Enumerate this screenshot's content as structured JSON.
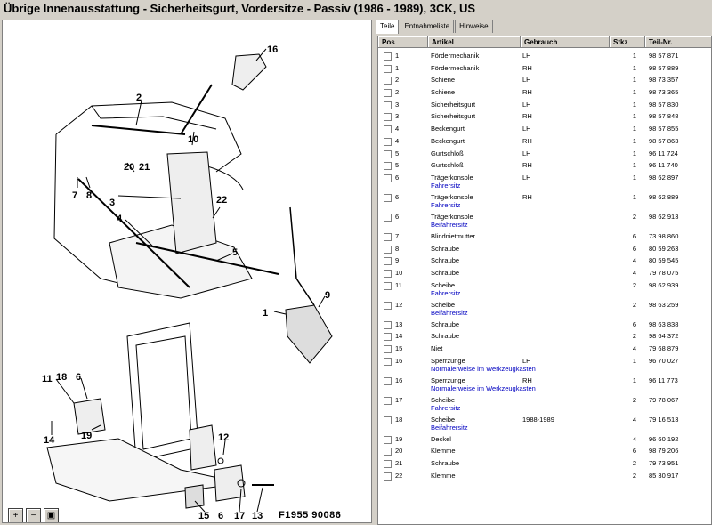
{
  "window": {
    "title": "Übrige Innenausstattung - Sicherheitsgurt, Vordersitze - Passiv   (1986 - 1989), 3CK, US"
  },
  "diagram": {
    "figure_label": "F1955   90086",
    "callouts": [
      "16",
      "2",
      "10",
      "20",
      "21",
      "7",
      "8",
      "3",
      "4",
      "22",
      "5",
      "9",
      "1",
      "11",
      "18",
      "6",
      "14",
      "19",
      "12",
      "15",
      "6",
      "17",
      "13"
    ],
    "zoom_buttons": [
      {
        "name": "zoom-in-icon",
        "glyph": "+"
      },
      {
        "name": "zoom-out-icon",
        "glyph": "−"
      },
      {
        "name": "fit-page-icon",
        "glyph": "▣"
      }
    ]
  },
  "tabs": [
    {
      "label": "Teile",
      "active": true
    },
    {
      "label": "Entnahmeliste",
      "active": false
    },
    {
      "label": "Hinweise",
      "active": false
    }
  ],
  "table": {
    "columns": [
      "Pos",
      "Artikel",
      "Gebrauch",
      "Stkz",
      "Teil-Nr."
    ],
    "rows": [
      {
        "pos": "1",
        "artikel": "Fördermechanik",
        "gebrauch": "LH",
        "stkz": "1",
        "teil": "98 57 871",
        "note": ""
      },
      {
        "pos": "1",
        "artikel": "Fördermechanik",
        "gebrauch": "RH",
        "stkz": "1",
        "teil": "98 57 889",
        "note": ""
      },
      {
        "pos": "2",
        "artikel": "Schiene",
        "gebrauch": "LH",
        "stkz": "1",
        "teil": "98 73 357",
        "note": ""
      },
      {
        "pos": "2",
        "artikel": "Schiene",
        "gebrauch": "RH",
        "stkz": "1",
        "teil": "98 73 365",
        "note": ""
      },
      {
        "pos": "3",
        "artikel": "Sicherheitsgurt",
        "gebrauch": "LH",
        "stkz": "1",
        "teil": "98 57 830",
        "note": ""
      },
      {
        "pos": "3",
        "artikel": "Sicherheitsgurt",
        "gebrauch": "RH",
        "stkz": "1",
        "teil": "98 57 848",
        "note": ""
      },
      {
        "pos": "4",
        "artikel": "Beckengurt",
        "gebrauch": "LH",
        "stkz": "1",
        "teil": "98 57 855",
        "note": ""
      },
      {
        "pos": "4",
        "artikel": "Beckengurt",
        "gebrauch": "RH",
        "stkz": "1",
        "teil": "98 57 863",
        "note": ""
      },
      {
        "pos": "5",
        "artikel": "Gurtschloß",
        "gebrauch": "LH",
        "stkz": "1",
        "teil": "96 11 724",
        "note": ""
      },
      {
        "pos": "5",
        "artikel": "Gurtschloß",
        "gebrauch": "RH",
        "stkz": "1",
        "teil": "96 11 740",
        "note": ""
      },
      {
        "pos": "6",
        "artikel": "Trägerkonsole",
        "gebrauch": "LH",
        "stkz": "1",
        "teil": "98 62 897",
        "note": "Fahrersitz"
      },
      {
        "pos": "6",
        "artikel": "Trägerkonsole",
        "gebrauch": "RH",
        "stkz": "1",
        "teil": "98 62 889",
        "note": "Fahrersitz"
      },
      {
        "pos": "6",
        "artikel": "Trägerkonsole",
        "gebrauch": "",
        "stkz": "2",
        "teil": "98 62 913",
        "note": "Beifahrersitz"
      },
      {
        "pos": "7",
        "artikel": "Blindnietmutter",
        "gebrauch": "",
        "stkz": "6",
        "teil": "73 98 860",
        "note": ""
      },
      {
        "pos": "8",
        "artikel": "Schraube",
        "gebrauch": "",
        "stkz": "6",
        "teil": "80 59 263",
        "note": ""
      },
      {
        "pos": "9",
        "artikel": "Schraube",
        "gebrauch": "",
        "stkz": "4",
        "teil": "80 59 545",
        "note": ""
      },
      {
        "pos": "10",
        "artikel": "Schraube",
        "gebrauch": "",
        "stkz": "4",
        "teil": "79 78 075",
        "note": ""
      },
      {
        "pos": "11",
        "artikel": "Scheibe",
        "gebrauch": "",
        "stkz": "2",
        "teil": "98 62 939",
        "note": "Fahrersitz"
      },
      {
        "pos": "12",
        "artikel": "Scheibe",
        "gebrauch": "",
        "stkz": "2",
        "teil": "98 63 259",
        "note": "Beifahrersitz"
      },
      {
        "pos": "13",
        "artikel": "Schraube",
        "gebrauch": "",
        "stkz": "6",
        "teil": "98 63 838",
        "note": ""
      },
      {
        "pos": "14",
        "artikel": "Schraube",
        "gebrauch": "",
        "stkz": "2",
        "teil": "98 64 372",
        "note": ""
      },
      {
        "pos": "15",
        "artikel": "Niet",
        "gebrauch": "",
        "stkz": "4",
        "teil": "79 68 879",
        "note": ""
      },
      {
        "pos": "16",
        "artikel": "Sperrzunge",
        "gebrauch": "LH",
        "stkz": "1",
        "teil": "96 70 027",
        "note": "Normalerweise im Werkzeugkasten"
      },
      {
        "pos": "16",
        "artikel": "Sperrzunge",
        "gebrauch": "RH",
        "stkz": "1",
        "teil": "96 11 773",
        "note": "Normalerweise im Werkzeugkasten"
      },
      {
        "pos": "17",
        "artikel": "Scheibe",
        "gebrauch": "",
        "stkz": "2",
        "teil": "79 78 067",
        "note": "Fahrersitz"
      },
      {
        "pos": "18",
        "artikel": "Scheibe",
        "gebrauch": "1988-1989",
        "stkz": "4",
        "teil": "79 16 513",
        "note": "Beifahrersitz"
      },
      {
        "pos": "19",
        "artikel": "Deckel",
        "gebrauch": "",
        "stkz": "4",
        "teil": "96 60 192",
        "note": ""
      },
      {
        "pos": "20",
        "artikel": "Klemme",
        "gebrauch": "",
        "stkz": "6",
        "teil": "98 79 206",
        "note": ""
      },
      {
        "pos": "21",
        "artikel": "Schraube",
        "gebrauch": "",
        "stkz": "2",
        "teil": "79 73 951",
        "note": ""
      },
      {
        "pos": "22",
        "artikel": "Klemme",
        "gebrauch": "",
        "stkz": "2",
        "teil": "85 30 917",
        "note": ""
      }
    ]
  }
}
